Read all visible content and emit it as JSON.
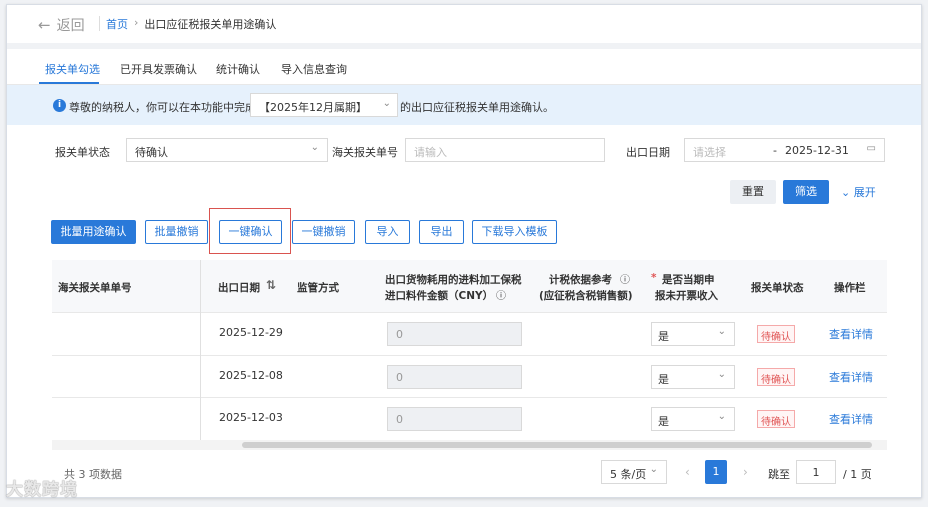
{
  "header": {
    "back_label": "返回",
    "breadcrumb_home": "首页",
    "breadcrumb_current": "出口应征税报关单用途确认"
  },
  "tabs": [
    "报关单勾选",
    "已开具发票确认",
    "统计确认",
    "导入信息查询"
  ],
  "notice": {
    "prefix": "尊敬的纳税人，你可以在本功能中完成",
    "period": "【2025年12月属期】",
    "suffix": "的出口应征税报关单用途确认。"
  },
  "filters": {
    "status_label": "报关单状态",
    "status_value": "待确认",
    "customs_no_label": "海关报关单号",
    "customs_no_placeholder": "请输入",
    "export_date_label": "出口日期",
    "date_start_placeholder": "请选择",
    "date_separator": "-",
    "date_end": "2025-12-31",
    "reset": "重置",
    "filter": "筛选",
    "expand": "展开"
  },
  "actions": [
    "批量用途确认",
    "批量撤销",
    "一键确认",
    "一键撤销",
    "导入",
    "导出",
    "下载导入模板"
  ],
  "table": {
    "headers": {
      "customs_no": "海关报关单单号",
      "export_date": "出口日期",
      "supervision": "监管方式",
      "amount_line1": "出口货物耗用的进料加工保税",
      "amount_line2": "进口料件金额（CNY）",
      "tax_ref_line1": "计税依据参考",
      "tax_ref_line2": "(应征税含税销售额)",
      "uninvoiced_line1": "是否当期申",
      "uninvoiced_line2": "报未开票收入",
      "status": "报关单状态",
      "ops": "操作栏"
    },
    "rows": [
      {
        "date": "2025-12-29",
        "amount": "0",
        "uninvoiced": "是",
        "status": "待确认",
        "action": "查看详情"
      },
      {
        "date": "2025-12-08",
        "amount": "0",
        "uninvoiced": "是",
        "status": "待确认",
        "action": "查看详情"
      },
      {
        "date": "2025-12-03",
        "amount": "0",
        "uninvoiced": "是",
        "status": "待确认",
        "action": "查看详情"
      }
    ]
  },
  "footer": {
    "total": "共 3 项数据",
    "page_size": "5 条/页",
    "current_page": "1",
    "jump_label": "跳至",
    "jump_value": "1",
    "total_pages": "/ 1 页"
  },
  "watermark": "大数跨境",
  "colors": {
    "primary": "#2979d9",
    "danger": "#e05555",
    "notice_bg": "#e6f1fc"
  }
}
